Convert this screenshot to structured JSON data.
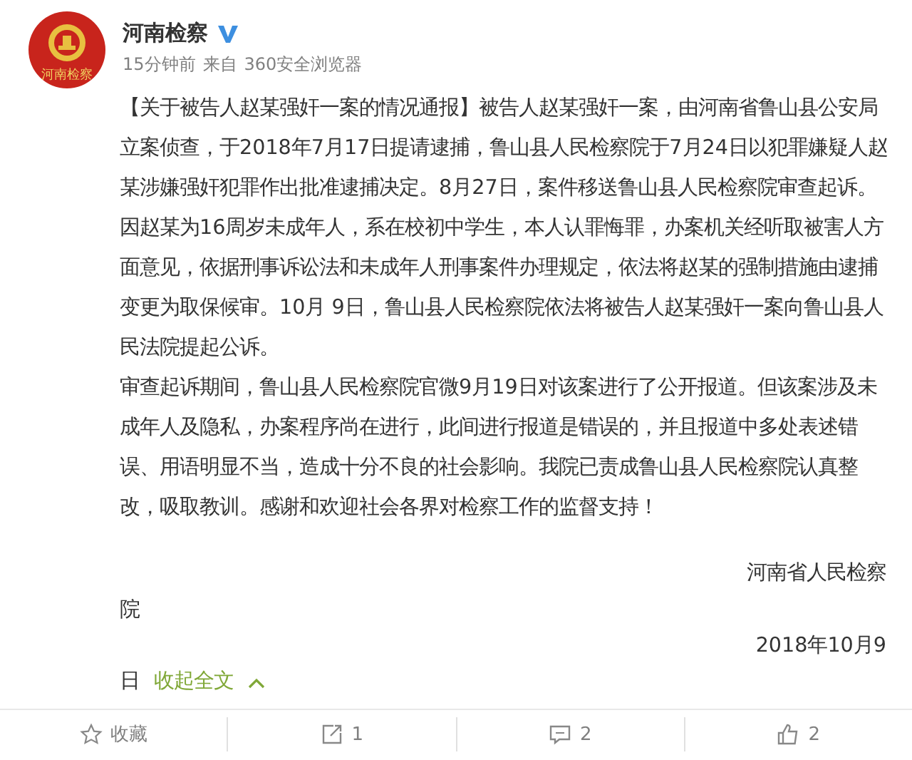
{
  "author": {
    "name": "河南检察",
    "verified": true,
    "avatar_text": "河南检察"
  },
  "meta": {
    "time": "15分钟前",
    "source_prefix": "来自",
    "source": "360安全浏览器"
  },
  "paragraphs": [
    "【关于被告人赵某强奸一案的情况通报】被告人赵某强奸一案，由河南省鲁山县公安局立案侦查，于2018年7月17日提请逮捕，鲁山县人民检察院于7月24日以犯罪嫌疑人赵某涉嫌强奸犯罪作出批准逮捕决定。8月27日，案件移送鲁山县人民检察院审查起诉。因赵某为16周岁未成年人，系在校初中学生，本人认罪悔罪，办案机关经听取被害人方面意见，依据刑事诉讼法和未成年人刑事案件办理规定，依法将赵某的强制措施由逮捕变更为取保候审。10月 9日，鲁山县人民检察院依法将被告人赵某强奸一案向鲁山县人民法院提起公诉。",
    "审查起诉期间，鲁山县人民检察院官微9月19日对该案进行了公开报道。但该案涉及未成年人及隐私，办案程序尚在进行，此间进行报道是错误的，并且报道中多处表述错误、用语明显不当，造成十分不良的社会影响。我院已责成鲁山县人民检察院认真整改，吸取教训。感谢和欢迎社会各界对检察工作的监督支持！"
  ],
  "signature_lines": [
    "河南省人民检察",
    "院"
  ],
  "date_lines": [
    "2018年10月9",
    "日"
  ],
  "collapse_link": "收起全文",
  "actions": [
    {
      "kind": "favorite",
      "label": "收藏"
    },
    {
      "kind": "repost",
      "label": "1"
    },
    {
      "kind": "comment",
      "label": "2"
    },
    {
      "kind": "like",
      "label": "2"
    }
  ]
}
